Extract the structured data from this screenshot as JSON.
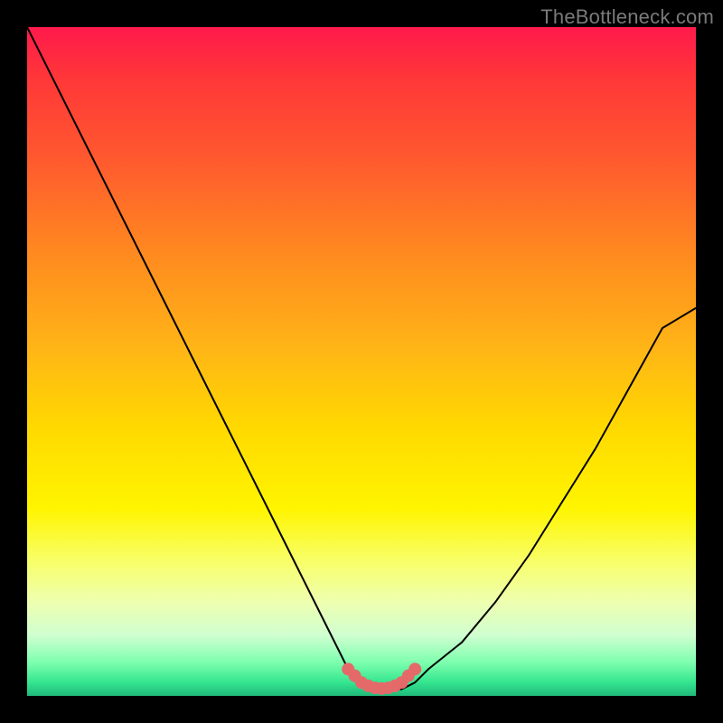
{
  "watermark": {
    "text": "TheBottleneck.com"
  },
  "chart_data": {
    "type": "line",
    "title": "",
    "xlabel": "",
    "ylabel": "",
    "xlim": [
      0,
      100
    ],
    "ylim": [
      0,
      100
    ],
    "grid": false,
    "legend": false,
    "series": [
      {
        "name": "bottleneck-curve",
        "x": [
          0,
          5,
          10,
          15,
          20,
          25,
          30,
          35,
          40,
          45,
          48,
          50,
          52,
          54,
          56,
          58,
          60,
          65,
          70,
          75,
          80,
          85,
          90,
          95,
          100
        ],
        "values": [
          100,
          90,
          80,
          70,
          60,
          50,
          40,
          30,
          20,
          10,
          4,
          2,
          1,
          1,
          1,
          2,
          4,
          8,
          14,
          21,
          29,
          37,
          46,
          55,
          58
        ]
      }
    ],
    "markers": {
      "name": "trough-markers",
      "color": "#e46a6a",
      "x": [
        48,
        49,
        50,
        51,
        52,
        53,
        54,
        55,
        56,
        57,
        58
      ],
      "values": [
        4,
        3,
        2,
        1.5,
        1.2,
        1.1,
        1.2,
        1.5,
        2,
        3,
        4
      ]
    },
    "background_gradient": {
      "stops": [
        {
          "pct": 0,
          "color": "#ff1a4b"
        },
        {
          "pct": 8,
          "color": "#ff3838"
        },
        {
          "pct": 20,
          "color": "#ff5a2e"
        },
        {
          "pct": 34,
          "color": "#ff8a1f"
        },
        {
          "pct": 48,
          "color": "#ffb516"
        },
        {
          "pct": 60,
          "color": "#ffd900"
        },
        {
          "pct": 72,
          "color": "#fff500"
        },
        {
          "pct": 80,
          "color": "#f8ff6a"
        },
        {
          "pct": 86,
          "color": "#eeffb0"
        },
        {
          "pct": 91,
          "color": "#cfffd0"
        },
        {
          "pct": 95,
          "color": "#7dffae"
        },
        {
          "pct": 98,
          "color": "#34e58f"
        },
        {
          "pct": 100,
          "color": "#1fb97a"
        }
      ]
    }
  }
}
